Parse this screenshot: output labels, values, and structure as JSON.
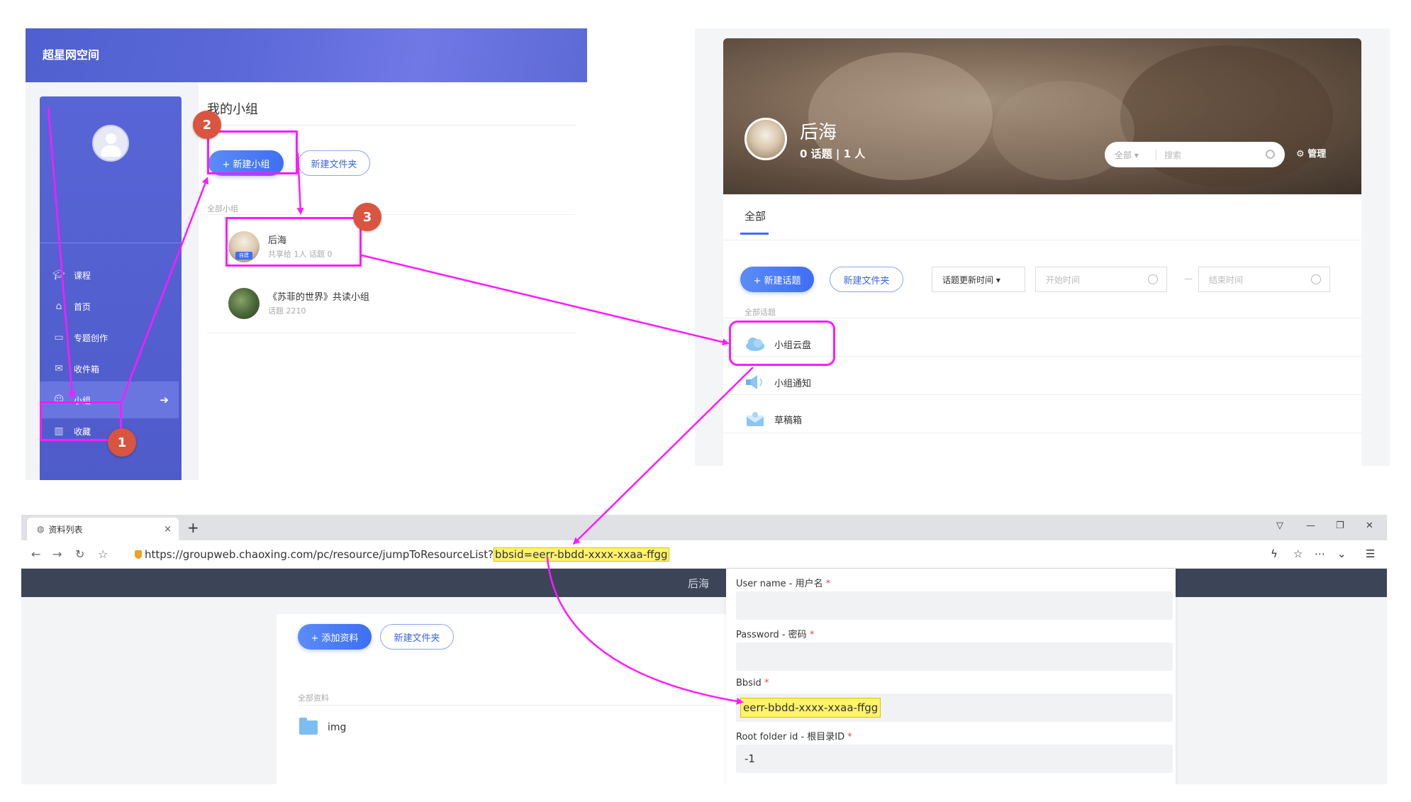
{
  "panel1": {
    "brand": "超星网空间",
    "sidebar": {
      "items": [
        {
          "label": "课程",
          "icon": "graduation-cap-icon"
        },
        {
          "label": "首页",
          "icon": "home-icon"
        },
        {
          "label": "专题创作",
          "icon": "monitor-icon"
        },
        {
          "label": "收件箱",
          "icon": "inbox-icon"
        },
        {
          "label": "小组",
          "icon": "group-icon",
          "active": true
        },
        {
          "label": "收藏",
          "icon": "book-icon"
        }
      ],
      "active_arrow": "➔"
    },
    "main": {
      "title": "我的小组",
      "new_group_button": "+ 新建小组",
      "new_folder_button": "新建文件夹",
      "section_label": "全部小组",
      "groups": [
        {
          "name": "后海",
          "meta": "共享给 1人   话题 0",
          "tag": "自建"
        },
        {
          "name": "《苏菲的世界》共读小组",
          "meta": "话题 2210"
        }
      ]
    }
  },
  "panel2": {
    "group_name": "后海",
    "stats": "0 话题  |  1 人",
    "search_scope": "全部 ▾",
    "search_placeholder": "搜索",
    "manage_label": "管理",
    "tab_all": "全部",
    "new_topic_button": "+ 新建话题",
    "new_folder_button": "新建文件夹",
    "sort_select": "话题更新时间 ▾",
    "start_time_placeholder": "开始时间",
    "end_time_placeholder": "结束时间",
    "dash": "—",
    "section_label": "全部话题",
    "rows": [
      {
        "label": "小组云盘",
        "icon": "cloud-icon"
      },
      {
        "label": "小组通知",
        "icon": "speaker-icon"
      },
      {
        "label": "草稿箱",
        "icon": "draft-box-icon"
      }
    ]
  },
  "panel3": {
    "tab_title": "资料列表",
    "tab_close": "×",
    "new_tab": "+",
    "url_prefix": "https://groupweb.chaoxing.com/pc/resource/jumpToResourceList?",
    "url_highlight": "bbsid=eerr-bbdd-xxxx-xxaa-ffgg",
    "header_title": "后海",
    "add_resource_button": "+ 添加资料",
    "new_folder_button": "新建文件夹",
    "section_label": "全部资料",
    "folder_name": "img",
    "form": {
      "username_label": "User name - 用户名",
      "password_label": "Password - 密码",
      "bbsid_label": "Bbsid",
      "bbsid_value": "eerr-bbdd-xxxx-xxaa-ffgg",
      "root_folder_label": "Root folder id - 根目录ID",
      "root_folder_value": "-1",
      "required_mark": "*"
    }
  },
  "badges": [
    "1",
    "2",
    "3"
  ],
  "colors": {
    "annotation": "#ff1aff",
    "badge": "#d9553f",
    "highlight": "#fff36b",
    "sidebar": "#5865d6",
    "primary": "#3f6ef2"
  }
}
